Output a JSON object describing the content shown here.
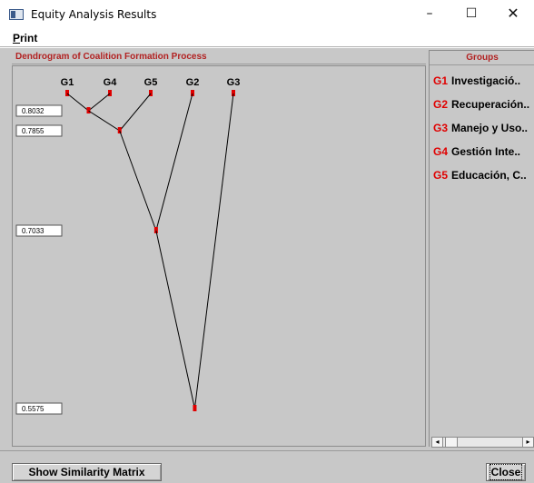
{
  "window": {
    "title": "Equity Analysis Results",
    "min_glyph": "–",
    "max_glyph": "☐",
    "close_glyph": "✕"
  },
  "menu": {
    "print_label": "Print"
  },
  "dendrogram": {
    "title": "Dendrogram of Coalition Formation Process",
    "leaf_order": [
      "G1",
      "G4",
      "G5",
      "G2",
      "G3"
    ],
    "similarity_levels": [
      "0.8032",
      "0.7855",
      "0.7033",
      "0.5575"
    ],
    "merges": [
      {
        "children": [
          "G1",
          "G4"
        ],
        "similarity": 0.8032
      },
      {
        "children": [
          "G1+G4",
          "G5"
        ],
        "similarity": 0.7855
      },
      {
        "children": [
          "G1+G4+G5",
          "G2"
        ],
        "similarity": 0.7033
      },
      {
        "children": [
          "G1+G4+G5+G2",
          "G3"
        ],
        "similarity": 0.5575
      }
    ],
    "node_color": "#e00000"
  },
  "groups": {
    "header": "Groups",
    "items": [
      {
        "code": "G1",
        "name": "Investigació.."
      },
      {
        "code": "G2",
        "name": "Recuperación.."
      },
      {
        "code": "G3",
        "name": "Manejo y Uso.."
      },
      {
        "code": "G4",
        "name": "Gestión Inte.."
      },
      {
        "code": "G5",
        "name": "Educación, C.."
      }
    ]
  },
  "scrollbar": {
    "left_glyph": "◂",
    "right_glyph": "▸"
  },
  "buttons": {
    "similarity_matrix": "Show Similarity Matrix",
    "close": "Close"
  },
  "colors": {
    "accent_red": "#b22222",
    "code_red": "#e00000",
    "panel_gray": "#c8c8c8"
  }
}
